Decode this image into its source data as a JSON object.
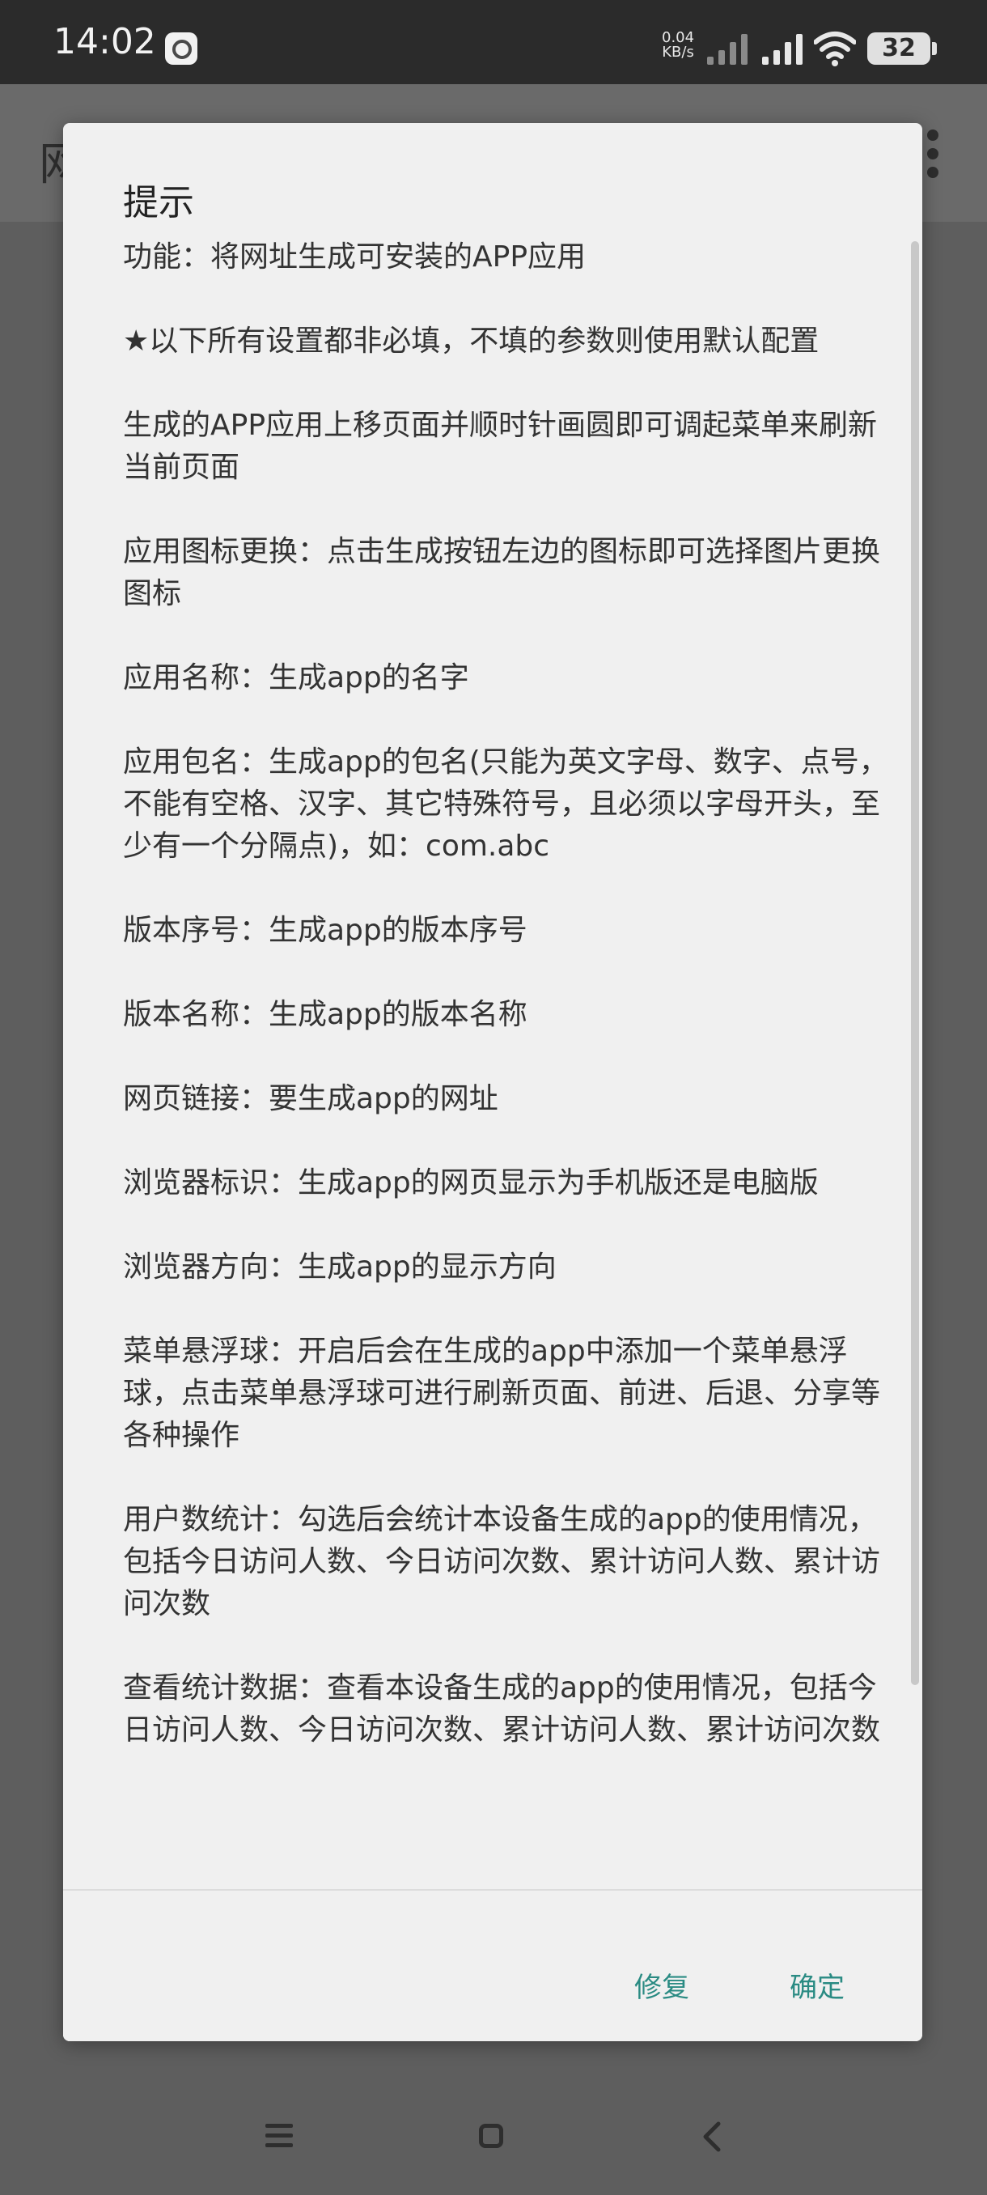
{
  "status_bar": {
    "time": "14:02",
    "net_speed_value": "0.04",
    "net_speed_unit": "KB/s",
    "battery": "32"
  },
  "background_app": {
    "title_fragment": "网"
  },
  "dialog": {
    "title": "提示",
    "paragraphs": [
      "功能：将网址生成可安装的APP应用",
      "★以下所有设置都非必填，不填的参数则使用默认配置",
      "生成的APP应用上移页面并顺时针画圆即可调起菜单来刷新当前页面",
      "应用图标更换：点击生成按钮左边的图标即可选择图片更换图标",
      "应用名称：生成app的名字",
      "应用包名：生成app的包名(只能为英文字母、数字、点号，不能有空格、汉字、其它特殊符号，且必须以字母开头，至少有一个分隔点)，如：com.abc",
      "版本序号：生成app的版本序号",
      "版本名称：生成app的版本名称",
      "网页链接：要生成app的网址",
      "浏览器标识：生成app的网页显示为手机版还是电脑版",
      "浏览器方向：生成app的显示方向",
      "菜单悬浮球：开启后会在生成的app中添加一个菜单悬浮球，点击菜单悬浮球可进行刷新页面、前进、后退、分享等各种操作",
      "用户数统计：勾选后会统计本设备生成的app的使用情况，包括今日访问人数、今日访问次数、累计访问人数、累计访问次数",
      "查看统计数据：查看本设备生成的app的使用情况，包括今日访问人数、今日访问次数、累计访问人数、累计访问次数"
    ],
    "repair_label": "修复",
    "ok_label": "确定"
  }
}
